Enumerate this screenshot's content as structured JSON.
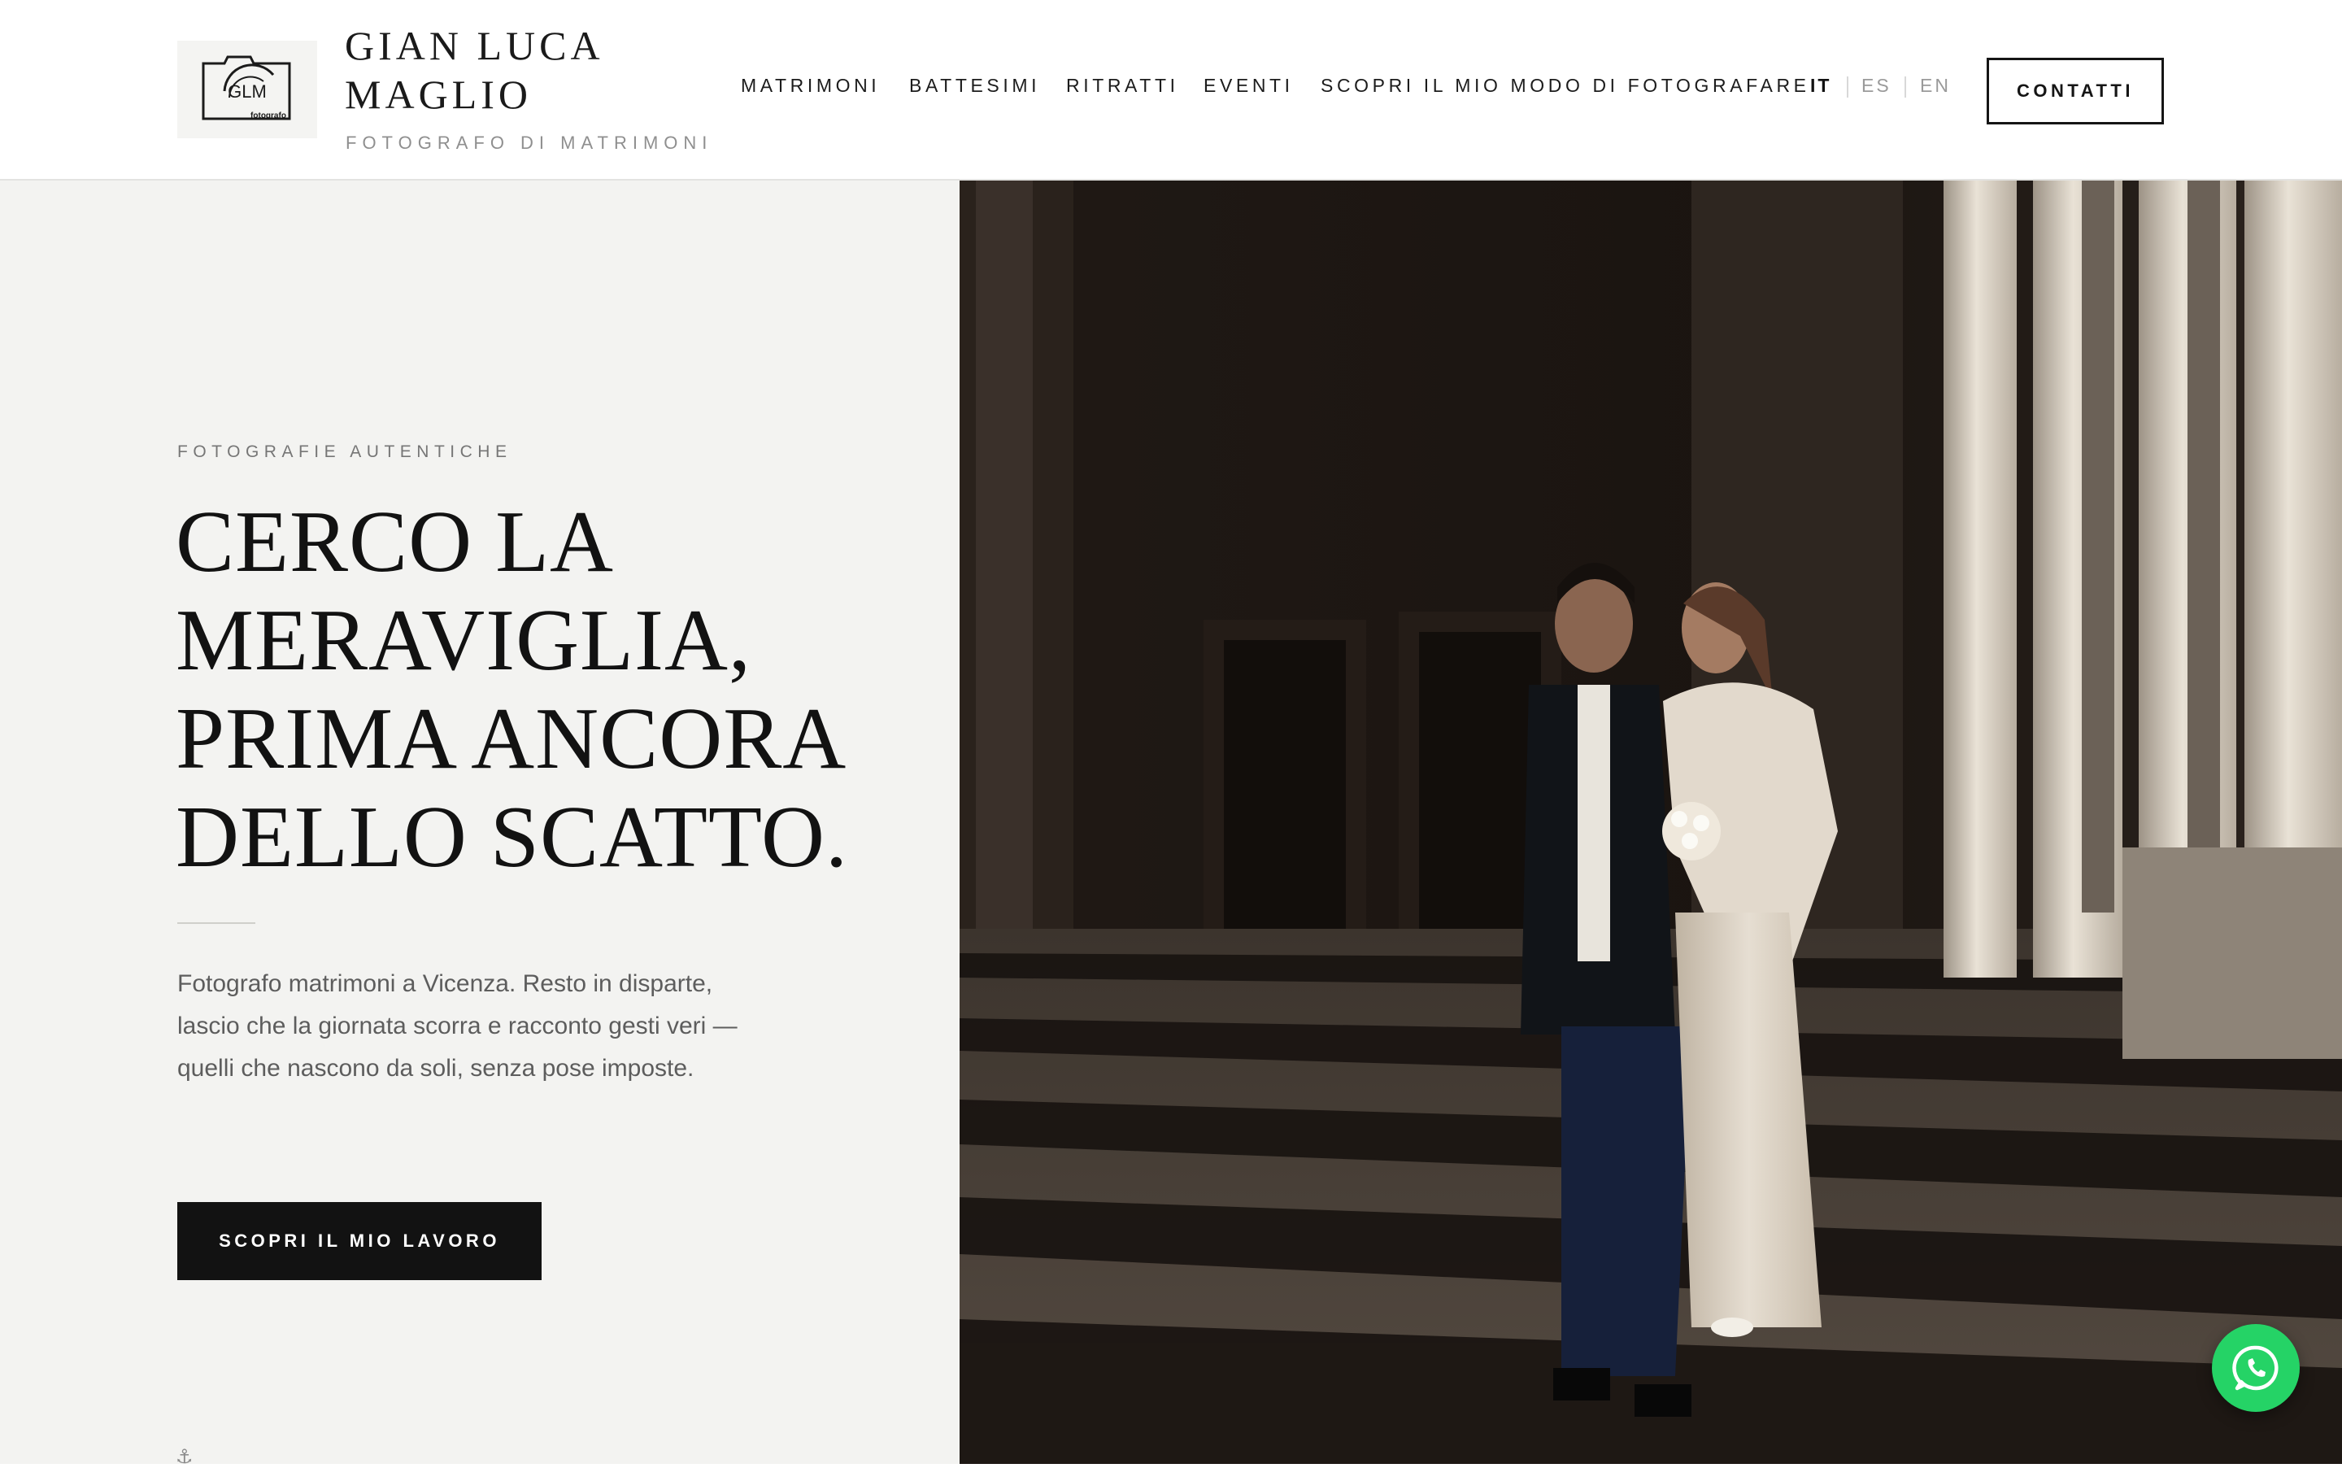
{
  "brand": {
    "logo_monogram": "GLM",
    "logo_sub": "fotografo",
    "name": "GIAN LUCA MAGLIO",
    "tagline": "FOTOGRAFO DI MATRIMONI"
  },
  "nav": {
    "items": [
      {
        "label": "MATRIMONI"
      },
      {
        "label": "BATTESIMI"
      },
      {
        "label": "RITRATTI"
      },
      {
        "label": "EVENTI"
      },
      {
        "label": "SCOPRI IL MIO MODO DI FOTOGRAFARE"
      }
    ],
    "languages": [
      {
        "label": "IT",
        "active": true
      },
      {
        "label": "ES",
        "active": false
      },
      {
        "label": "EN",
        "active": false
      }
    ],
    "contact_label": "CONTATTI"
  },
  "hero": {
    "eyebrow": "FOTOGRAFIE AUTENTICHE",
    "headline": "CERCO LA MERAVIGLIA, PRIMA ANCORA DELLO SCATTO.",
    "intro": "Fotografo matrimoni a Vicenza. Resto in disparte, lascio che la giornata scorra e racconto gesti veri — quelli che nascono da soli, senza pose imposte.",
    "cta_label": "SCOPRI IL MIO LAVORO",
    "scroll_icon": "anchor-icon"
  },
  "photo": {
    "subject": "wedding-couple-under-colonnade"
  },
  "floating": {
    "whatsapp_icon": "whatsapp-icon"
  },
  "colors": {
    "accent_dark": "#121212",
    "panel_bg": "#f3f3f1",
    "whatsapp_green": "#25d366"
  }
}
